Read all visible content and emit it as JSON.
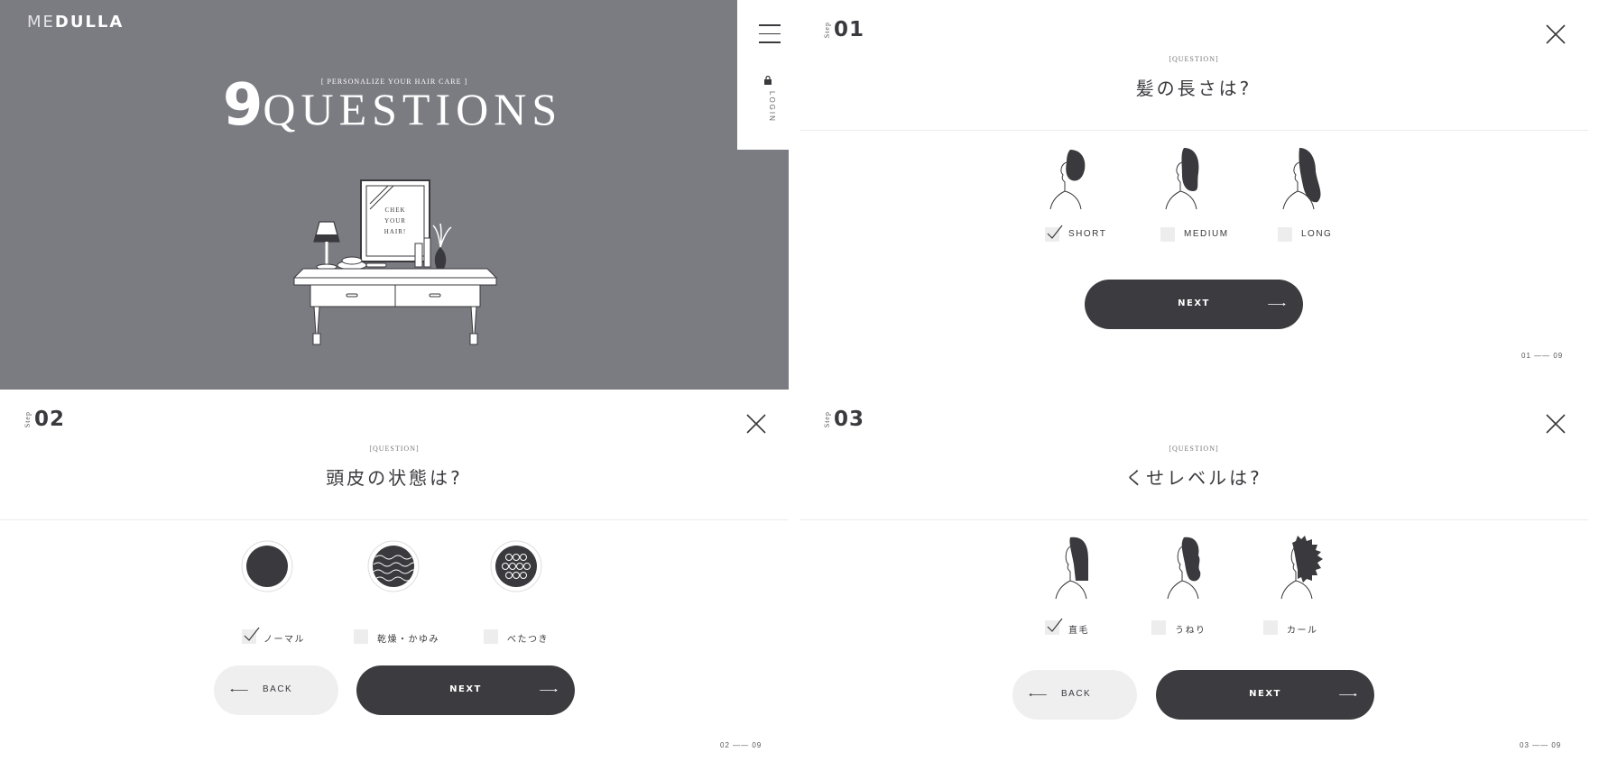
{
  "brand": {
    "logo_light": "ME",
    "logo_bold": "DULLA"
  },
  "hero": {
    "subtitle": "[ PERSONALIZE YOUR HAIR CARE ]",
    "title_number": "9",
    "title_word": "QUESTIONS",
    "mirror_text": [
      "CHEK",
      "YOUR",
      "HAIR!"
    ]
  },
  "menu": {
    "login_label": "LOGIN"
  },
  "colors": {
    "hero_bg": "#7b7b82",
    "button_dark": "#3c3c40",
    "button_light": "#efeff0",
    "text": "#3a3a3e"
  },
  "steps": [
    {
      "step_word": "Step",
      "step_number": "01",
      "question_label": "[QUESTION]",
      "question": "髪の長さは?",
      "options": [
        {
          "label": "SHORT",
          "checked": true,
          "icon": "short-hair-icon"
        },
        {
          "label": "MEDIUM",
          "checked": false,
          "icon": "medium-hair-icon"
        },
        {
          "label": "LONG",
          "checked": false,
          "icon": "long-hair-icon"
        }
      ],
      "next_label": "NEXT",
      "progress_current": "01",
      "progress_total": "09"
    },
    {
      "step_word": "Step",
      "step_number": "02",
      "question_label": "[QUESTION]",
      "question": "頭皮の状態は?",
      "options": [
        {
          "label": "ノーマル",
          "checked": true,
          "icon": "normal-scalp-icon"
        },
        {
          "label": "乾燥・かゆみ",
          "checked": false,
          "icon": "dry-scalp-icon"
        },
        {
          "label": "べたつき",
          "checked": false,
          "icon": "oily-scalp-icon"
        }
      ],
      "back_label": "BACK",
      "next_label": "NEXT",
      "progress_current": "02",
      "progress_total": "09"
    },
    {
      "step_word": "Step",
      "step_number": "03",
      "question_label": "[QUESTION]",
      "question": "くせレベルは?",
      "options": [
        {
          "label": "直毛",
          "checked": true,
          "icon": "straight-hair-icon"
        },
        {
          "label": "うねり",
          "checked": false,
          "icon": "wavy-hair-icon"
        },
        {
          "label": "カール",
          "checked": false,
          "icon": "curly-hair-icon"
        }
      ],
      "back_label": "BACK",
      "next_label": "NEXT",
      "progress_current": "03",
      "progress_total": "09"
    }
  ]
}
